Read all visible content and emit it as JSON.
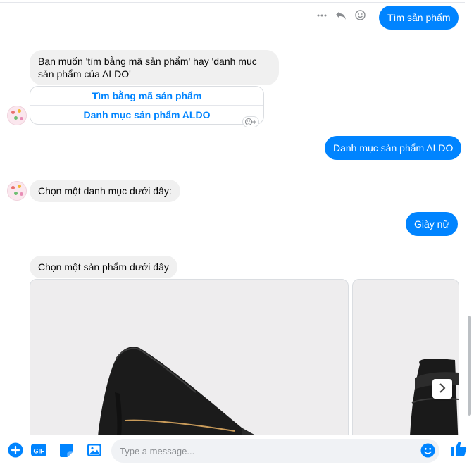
{
  "messages": {
    "out1": "Tìm sản phẩm",
    "in1": "Bạn muốn 'tìm bằng mã sản phẩm' hay 'danh mục sản phẩm của ALDO'",
    "quick_replies": [
      "Tìm bằng mã sản phẩm",
      "Danh mục sản phẩm ALDO"
    ],
    "out2": "Danh mục sản phẩm ALDO",
    "in2": "Chọn một danh mục dưới đây:",
    "out3": "Giày nữ",
    "in3": "Chọn một sản phẩm dưới đây"
  },
  "composer": {
    "placeholder": "Type a message..."
  },
  "colors": {
    "accent": "#0084ff",
    "incoming_bubble": "#f0f0f0",
    "card_bg": "#eeedee"
  },
  "icons": {
    "more": "more-icon",
    "reply": "reply-icon",
    "react": "emoji-react-icon",
    "add": "plus-circle-icon",
    "gif": "gif-icon",
    "sticker": "sticker-icon",
    "photo": "photo-icon",
    "emoji": "emoji-icon",
    "like": "thumbs-up-icon",
    "next": "chevron-right-icon"
  }
}
